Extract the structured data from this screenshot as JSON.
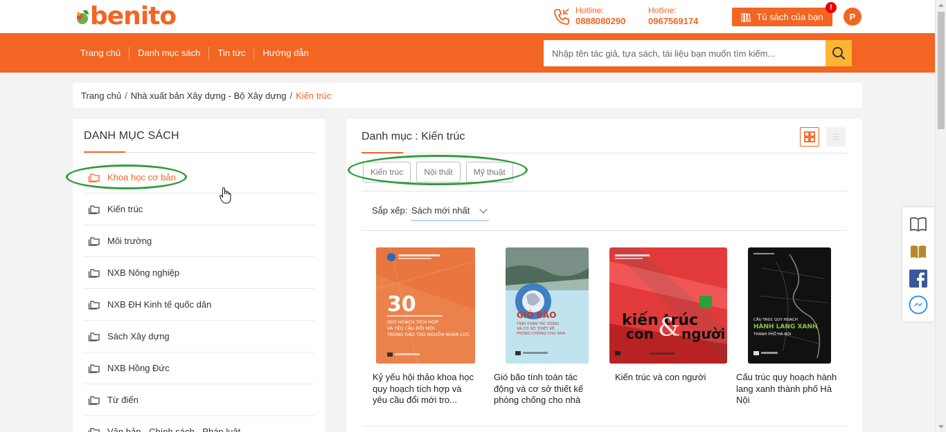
{
  "header": {
    "logo_text": "benito",
    "hotlines": [
      {
        "label": "Hotline:",
        "number": "0888080290"
      },
      {
        "label": "Hotline:",
        "number": "0967569174"
      }
    ],
    "bookshelf_label": "Tủ sách của bạn",
    "notification_badge": "!",
    "avatar_letter": "P",
    "brand_color": "#f26522"
  },
  "nav": {
    "links": [
      "Trang chủ",
      "Danh mục sách",
      "Tin tức",
      "Hướng dẫn"
    ],
    "search_placeholder": "Nhập tên tác giả, tựa sách, tài liệu bạn muốn tìm kiếm..."
  },
  "breadcrumb": {
    "items": [
      "Trang chủ",
      "Nhà xuất bản Xây dựng - Bộ Xây dựng"
    ],
    "current": "Kiến trúc"
  },
  "sidebar": {
    "title": "DANH MỤC SÁCH",
    "items": [
      {
        "label": "Khoa học cơ bản",
        "active": true
      },
      {
        "label": "Kiến trúc",
        "active": false
      },
      {
        "label": "Môi trường",
        "active": false
      },
      {
        "label": "NXB Nông nghiệp",
        "active": false
      },
      {
        "label": "NXB ĐH Kinh tế quốc dân",
        "active": false
      },
      {
        "label": "Sách Xây dựng",
        "active": false
      },
      {
        "label": "NXB Hồng Đức",
        "active": false
      },
      {
        "label": "Từ điển",
        "active": false
      },
      {
        "label": "Văn bản - Chính sách - Pháp luật",
        "active": false
      }
    ]
  },
  "main": {
    "title": "Danh mục : Kiến trúc",
    "subcategories": [
      "Kiến trúc",
      "Nội thất",
      "Mỹ thuật"
    ],
    "sort_label": "Sắp xếp:",
    "sort_value": "Sách mới nhất",
    "books": [
      {
        "title": "Kỷ yếu hội thảo khoa học quy hoạch tích hợp và yêu cầu đổi mới tro...",
        "cover": {
          "number": "30",
          "heading": "QUY HOẠCH TÍCH HỢP VÀ YÊU CẦU ĐỔI MỚI TRONG ĐÀO TẠO NGUỒN NHÂN LỰC",
          "bg": "#e8763e"
        }
      },
      {
        "title": "Gió bão tính toán tác động và cơ sở thiết kế phòng chống cho nhà",
        "cover": {
          "heading": "GIÓ BÃO",
          "sub": "TÍNH TOÁN TÁC ĐỘNG VÀ CƠ SỞ THIẾT KẾ PHÒNG CHỐNG CHO NHÀ",
          "bg": "#bfe3ef"
        }
      },
      {
        "title": "Kiến trúc và con người",
        "cover": {
          "heading": "kiến trúc & con người",
          "bg": "#e23a3a"
        }
      },
      {
        "title": "Cấu trúc quy hoạch hành lang xanh thành phố Hà Nội",
        "cover": {
          "heading": "HÀNH LANG XANH",
          "pre": "CẤU TRÚC QUY HOẠCH",
          "sub": "THÀNH PHỐ HÀ NỘI",
          "bg": "#111111"
        }
      }
    ]
  },
  "float_widget": {
    "icons": [
      "open-book-icon",
      "book-icon",
      "facebook-icon",
      "messenger-icon"
    ]
  },
  "annotation_color": "#2e9e3a"
}
